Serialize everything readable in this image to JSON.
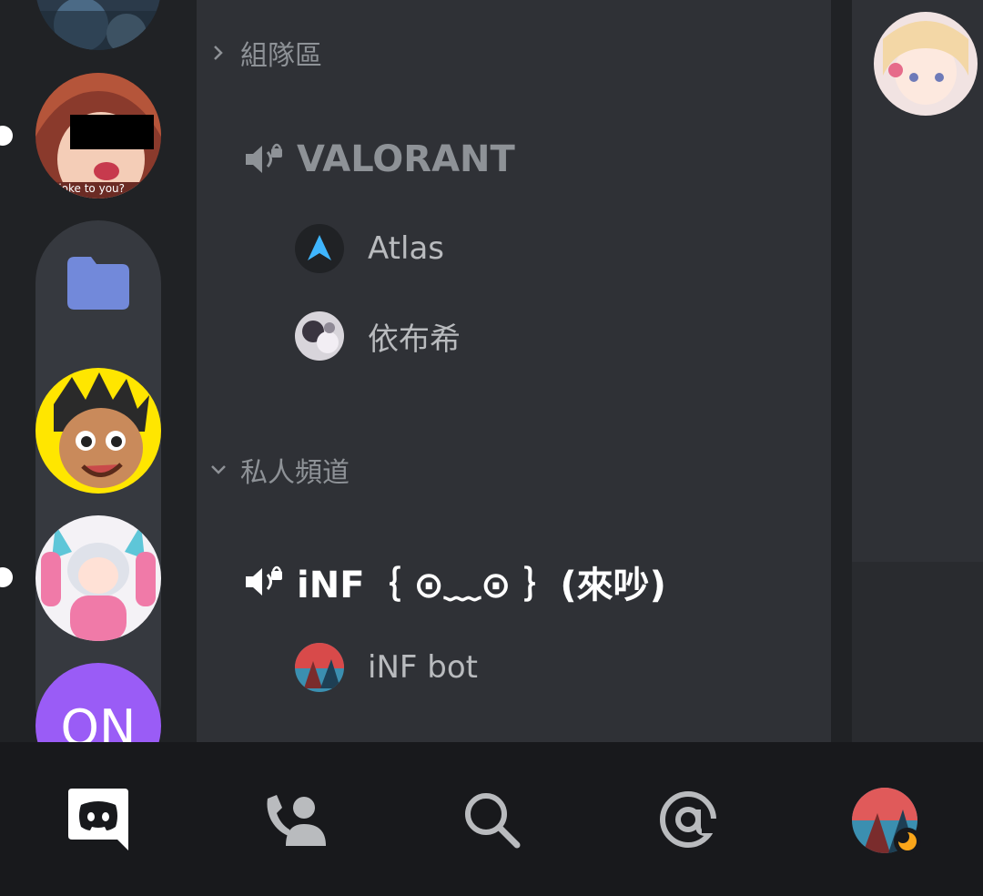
{
  "server_rail": {
    "items": [
      {
        "name": "server-avatar-1",
        "unread": false
      },
      {
        "name": "server-avatar-2",
        "unread": true,
        "caption": "lioke to you?"
      },
      {
        "name": "server-folder",
        "unread": false
      },
      {
        "name": "server-avatar-3",
        "unread": false
      },
      {
        "name": "server-avatar-4",
        "unread": true
      },
      {
        "name": "server-avatar-on",
        "label": "ON"
      }
    ],
    "folder_color": "#7289da",
    "on_color": "#9a5cf6"
  },
  "channel_list": {
    "categories": [
      {
        "label": "組隊區",
        "collapsed": true,
        "channels": [
          {
            "name": "VALORANT",
            "type": "voice",
            "locked": true,
            "active": false,
            "members": [
              {
                "name": "Atlas",
                "avatar_icon": "atlas-logo-icon"
              },
              {
                "name": "依布希",
                "avatar_icon": "user-avatar"
              }
            ]
          }
        ]
      },
      {
        "label": "私人頻道",
        "collapsed": false,
        "channels": [
          {
            "name": "iNF｛ ⊙﹏⊙ ｝(來吵)",
            "type": "voice",
            "locked": true,
            "active": true,
            "members": [
              {
                "name": "iNF bot",
                "avatar_icon": "bot-avatar"
              }
            ]
          }
        ]
      }
    ]
  },
  "bottom_nav": {
    "tabs": [
      {
        "name": "home",
        "icon": "discord-logo-icon",
        "active": true
      },
      {
        "name": "friends",
        "icon": "friends-icon",
        "active": false
      },
      {
        "name": "search",
        "icon": "search-icon",
        "active": false
      },
      {
        "name": "mentions",
        "icon": "at-icon",
        "active": false
      },
      {
        "name": "profile",
        "icon": "user-avatar",
        "active": false,
        "status": "idle"
      }
    ]
  },
  "colors": {
    "background": "#202225",
    "channel_bg": "#2f3136",
    "muted_text": "#8e9297",
    "active_text": "#ffffff",
    "accent": "#5865f2",
    "idle": "#faa61a"
  }
}
